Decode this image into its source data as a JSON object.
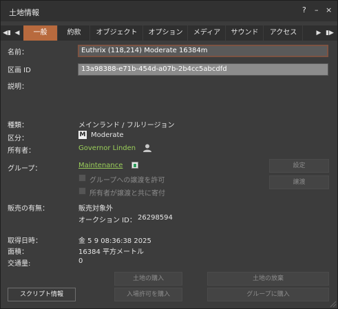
{
  "window": {
    "title": "土地情報",
    "help_label": "?",
    "minimize_label": "–",
    "close_label": "×"
  },
  "tabs": [
    {
      "label": "一般",
      "active": true
    },
    {
      "label": "約款",
      "active": false
    },
    {
      "label": "オブジェクト",
      "active": false
    },
    {
      "label": "オプション",
      "active": false
    },
    {
      "label": "メディア",
      "active": false
    },
    {
      "label": "サウンド",
      "active": false
    },
    {
      "label": "アクセス",
      "active": false
    }
  ],
  "general": {
    "name_label": "名前：",
    "name_value": "Euthrix (118,214) Moderate 16384m",
    "region_id_label": "区画 ID",
    "region_id_value": "13a98388-e71b-454d-a07b-2b4cc5abcdfd",
    "description_label": "説明：",
    "type_label": "種類：",
    "type_value": "メインランド / フルリージョン",
    "rating_label": "区分：",
    "rating_badge": "M",
    "rating_value": "Moderate",
    "owner_label": "所有者：",
    "owner_value": "Governor Linden",
    "group_label": "グループ：",
    "group_value": "Maintenance",
    "settings_button": "設定",
    "deed_button": "譲渡",
    "allow_deed_label": "グループへの譲渡を許可",
    "owner_contrib_label": "所有者が譲渡と共に寄付",
    "for_sale_label": "販売の有無：",
    "for_sale_value": "販売対象外",
    "auction_label": "オークション ID：",
    "auction_id": "26298594",
    "claimed_label": "取得日時：",
    "claimed_value": "金 5 9 08:36:38 2025",
    "area_label": "面積：",
    "area_value": "16384 平方メートル",
    "traffic_label": "交通量:",
    "traffic_value": "0",
    "buy_land_button": "土地の購入",
    "abandon_land_button": "土地の放棄",
    "script_info_button": "スクリプト情報",
    "buy_pass_button": "入場許可を購入",
    "buy_for_group_button": "グループに購入"
  },
  "colors": {
    "active_tab": "#b86a3e",
    "link": "#9bcf5a",
    "background": "#3c3c3c"
  }
}
